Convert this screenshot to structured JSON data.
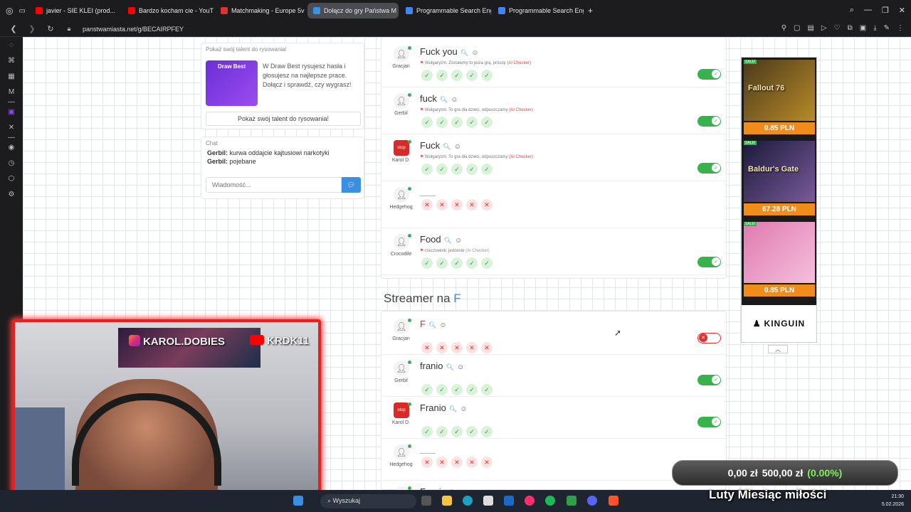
{
  "browser": {
    "tabs": [
      {
        "label": "javier - SIE KLEI (prod...",
        "color": "#ff0000"
      },
      {
        "label": "Bardzo kocham cie - YouT",
        "color": "#ff0000"
      },
      {
        "label": "Matchmaking - Europe 5v",
        "color": "#e03131"
      },
      {
        "label": "Dołącz do gry Państwa M",
        "color": "#3b8fe0"
      },
      {
        "label": "Programmable Search Eng",
        "color": "#4285f4"
      },
      {
        "label": "Programmable Search Eng",
        "color": "#4285f4"
      }
    ],
    "new_tab": "+",
    "url": "panstwamiasta.net/g/BECAIRPFEY"
  },
  "draw_card": {
    "title": "Pokaż swój talent do rysowania!",
    "image_label": "Draw Best",
    "description": "W Draw Best rysujesz hasła i głosujesz na najlepsze prace. Dołącz i sprawdź, czy wygrasz!",
    "button": "Pokaż swój talent do rysowania!"
  },
  "chat": {
    "title": "Chat",
    "messages": [
      {
        "user": "Gerbil:",
        "text": "kurwa oddajcie kajtusiowi narkotyki"
      },
      {
        "user": "Gerbil:",
        "text": "pojebane"
      }
    ],
    "placeholder": "Wiadomość..."
  },
  "answers_top": [
    {
      "player": "Gracjan",
      "word": "Fuck you",
      "note": "Wulgaryzm. Zostawmy to poza grą, proszę",
      "note_ai": "(AI Checker)",
      "votes": [
        "ok",
        "ok",
        "ok",
        "ok",
        "ok"
      ],
      "accepted": true
    },
    {
      "player": "Gerbil",
      "word": "fuck",
      "note": "Wulgaryzm. To gra dla dzieci, odpuszczamy",
      "note_ai": "(AI Checker)",
      "votes": [
        "ok",
        "ok",
        "ok",
        "ok",
        "ok"
      ],
      "accepted": true
    },
    {
      "player": "Karol D.",
      "word": "Fuck",
      "note": "Wulgaryzm. To gra dla dzieci, odpuszczamy",
      "note_ai": "(AI Checker)",
      "votes": [
        "ok",
        "ok",
        "ok",
        "ok",
        "ok"
      ],
      "accepted": true
    },
    {
      "player": "Hedgehog",
      "word": "",
      "note": "",
      "note_ai": "",
      "votes": [
        "no",
        "no",
        "no",
        "no",
        "no"
      ],
      "accepted": null
    },
    {
      "player": "Crocodile",
      "word": "Food",
      "note": "rzeczownik: jedzenie",
      "note_ai": "(AI Checker)",
      "votes": [
        "ok",
        "ok",
        "ok",
        "ok",
        "ok"
      ],
      "accepted": true
    }
  ],
  "section": {
    "title": "Streamer na",
    "letter": "F"
  },
  "answers_bottom": [
    {
      "player": "Gracjan",
      "word": "F",
      "votes": [
        "no",
        "no",
        "no",
        "no",
        "no"
      ],
      "accepted": false
    },
    {
      "player": "Gerbil",
      "word": "franio",
      "votes": [
        "ok",
        "ok",
        "ok",
        "ok",
        "ok"
      ],
      "accepted": true
    },
    {
      "player": "Karol D.",
      "word": "Franio",
      "votes": [
        "ok",
        "ok",
        "ok",
        "ok",
        "ok"
      ],
      "accepted": true
    },
    {
      "player": "Hedgehog",
      "word": "",
      "votes": [
        "no",
        "no",
        "no",
        "no",
        "no"
      ],
      "accepted": null
    },
    {
      "player": "",
      "word": "Franio",
      "votes": [],
      "accepted": null
    }
  ],
  "ads": {
    "sale": "SALE!",
    "games": [
      {
        "title": "Fallout 76",
        "price": "0.85 PLN",
        "color1": "#4a3a1a",
        "color2": "#b88a2a"
      },
      {
        "title": "Baldur's Gate",
        "price": "67.28 PLN",
        "color1": "#1a1a3a",
        "color2": "#7a5a9a"
      },
      {
        "title": "",
        "price": "0.85 PLN",
        "color1": "#e07ab0",
        "color2": "#f5c0dc"
      }
    ],
    "brand": "KINGUIN"
  },
  "stream": {
    "instagram": "KAROL.DOBIES",
    "youtube": "KRDK11",
    "donation_left": "0,00 zł",
    "donation_right": "500,00 zł",
    "donation_pct": "(0.00%)",
    "banner": "Luty Miesiąc miłości"
  },
  "taskbar": {
    "search": "Wyszukaj",
    "time": "21:30",
    "date": "5.02.2026"
  },
  "colors": {
    "accent": "#3b8fe0",
    "ok": "#37b24d",
    "error": "#e03131",
    "cam_border": "#e52020"
  }
}
